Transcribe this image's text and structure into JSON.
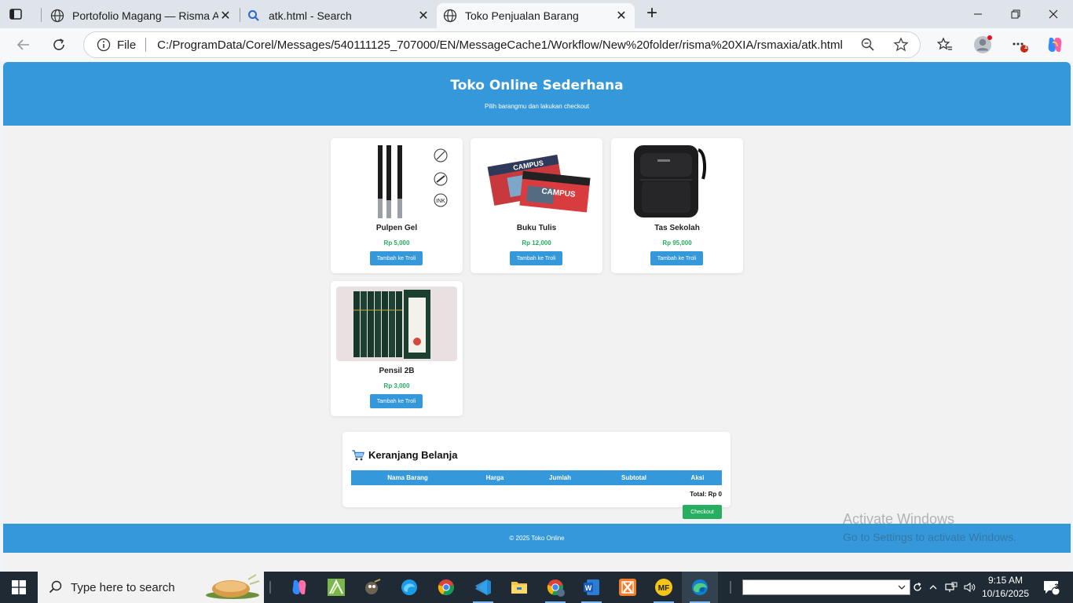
{
  "browser": {
    "tabs": [
      {
        "title": "Portofolio Magang — Risma Apria"
      },
      {
        "title": "atk.html - Search"
      },
      {
        "title": "Toko Penjualan Barang"
      }
    ],
    "address": {
      "scheme_label": "File",
      "url": "C:/ProgramData/Corel/Messages/540111125_707000/EN/MessageCache1/Workflow/New%20folder/risma%20XIA/rsmaxia/atk.html"
    },
    "notification_count": "1"
  },
  "page": {
    "header": {
      "title": "Toko Online Sederhana",
      "subtitle": "Pilih barangmu dan lakukan checkout"
    },
    "products": [
      {
        "name": "Pulpen Gel",
        "price": "Rp 5,000",
        "button": "Tambah ke Troli"
      },
      {
        "name": "Buku Tulis",
        "price": "Rp 12,000",
        "button": "Tambah ke Troli"
      },
      {
        "name": "Tas Sekolah",
        "price": "Rp 95,000",
        "button": "Tambah ke Troli"
      },
      {
        "name": "Pensil 2B",
        "price": "Rp 3,000",
        "button": "Tambah ke Troli"
      }
    ],
    "cart": {
      "title": "Keranjang Belanja",
      "columns": [
        "Nama Barang",
        "Harga",
        "Jumlah",
        "Subtotal",
        "Aksi"
      ],
      "total": "Total: Rp 0",
      "checkout": "Checkout"
    },
    "footer": "© 2025 Toko Online"
  },
  "watermark": {
    "line1": "Activate Windows",
    "line2": "Go to Settings to activate Windows."
  },
  "taskbar": {
    "search_placeholder": "Type here to search",
    "time": "9:15 AM",
    "date": "10/16/2025",
    "notifications": "3"
  },
  "colors": {
    "primary": "#3598db",
    "success": "#27ae60",
    "page_bg": "#f2f2f2"
  }
}
